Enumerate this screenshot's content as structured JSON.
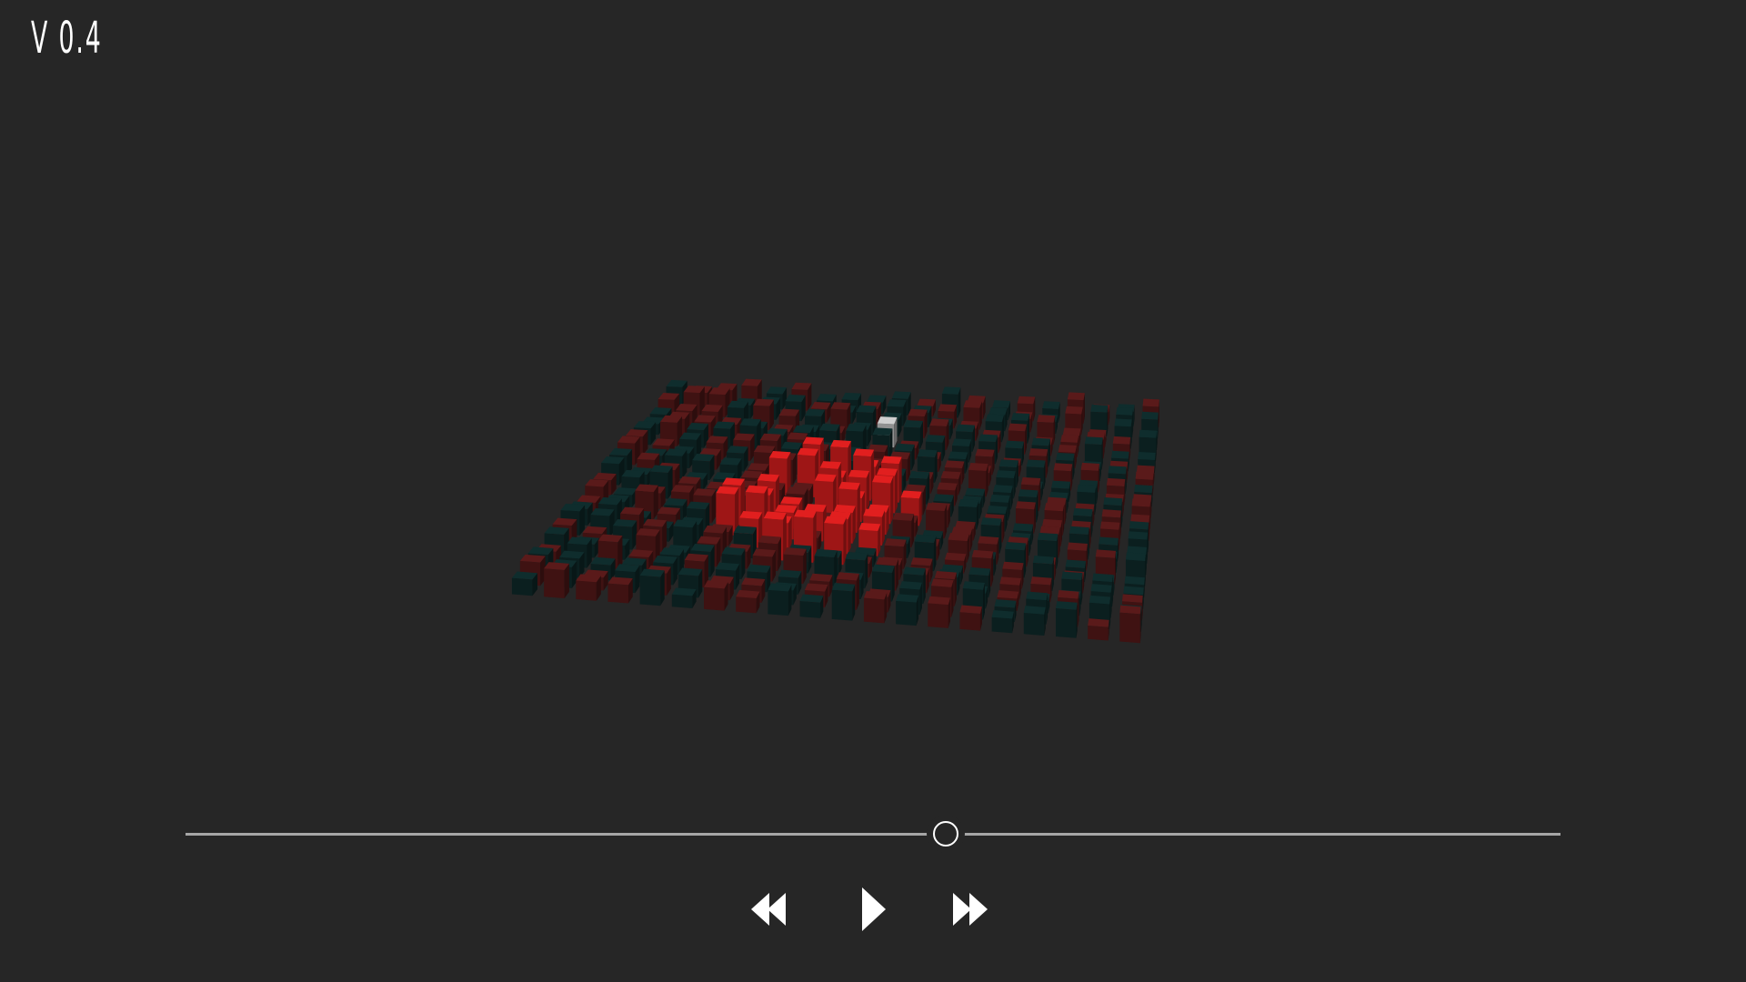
{
  "app": {
    "version_label": "V 0.4"
  },
  "scene": {
    "description_icon": "voxel-grid-3d",
    "colors": {
      "background": "#262626",
      "bright_red": "#e11f1f",
      "dark_red": "#5a1a1a",
      "dark_teal": "#0f2d2d",
      "highlight_cube": "#cfcfcf"
    }
  },
  "timeline": {
    "progress": 0.553
  },
  "controls": {
    "rewind_icon": "rewind-icon",
    "play_icon": "play-icon",
    "fast_forward_icon": "fast-forward-icon",
    "icon_color": "#ffffff"
  }
}
